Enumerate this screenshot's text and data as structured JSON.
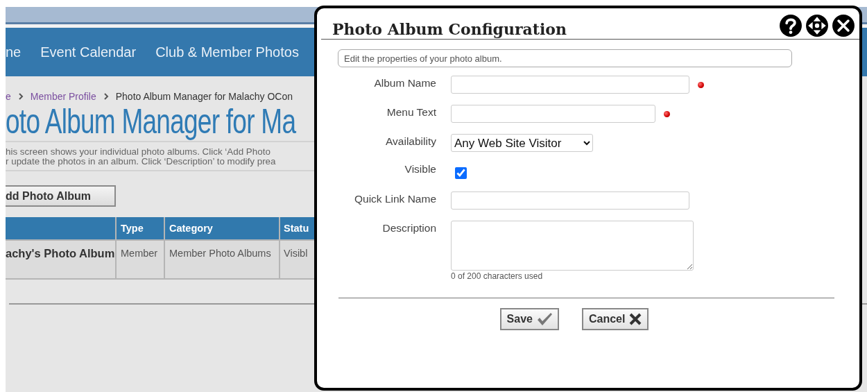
{
  "page": {
    "nav_items": [
      "ne",
      "Event Calendar",
      "Club & Member Photos"
    ],
    "breadcrumb": [
      {
        "label": "e",
        "link": true
      },
      {
        "label": "Member Profile",
        "link": true
      },
      {
        "label": "Photo Album Manager for Malachy OCon",
        "link": false
      }
    ],
    "heading": "oto Album Manager for Ma",
    "intro_lines": [
      "his screen shows your individual photo albums. Click ‘Add Photo",
      "r update the photos in an album. Click ‘Description’ to modify prea"
    ],
    "add_button": "dd Photo Album",
    "table": {
      "columns": [
        "Type",
        "Category",
        "Statu"
      ],
      "rows": [
        {
          "name": "achy's Photo Album",
          "cells": [
            "Member",
            "Member Photo Albums",
            "Visibl"
          ]
        }
      ]
    }
  },
  "dialog": {
    "title": "Photo Album Configuration",
    "instructions": "Edit the properties of your photo album.",
    "fields": [
      {
        "kind": "text",
        "label": "Album Name",
        "required": true
      },
      {
        "kind": "text",
        "label": "Menu Text",
        "required": true
      },
      {
        "kind": "select",
        "label": "Availability",
        "value": "Any Web Site Visitor"
      },
      {
        "kind": "checkbox",
        "label": "Visible",
        "checked": true
      },
      {
        "kind": "text",
        "label": "Quick Link Name",
        "required": false
      },
      {
        "kind": "textarea",
        "label": "Description",
        "counter": "0 of 200 characters used"
      }
    ],
    "buttons": [
      {
        "label": "Save",
        "kind": "save"
      },
      {
        "label": "Cancel",
        "kind": "cancel"
      }
    ]
  }
}
